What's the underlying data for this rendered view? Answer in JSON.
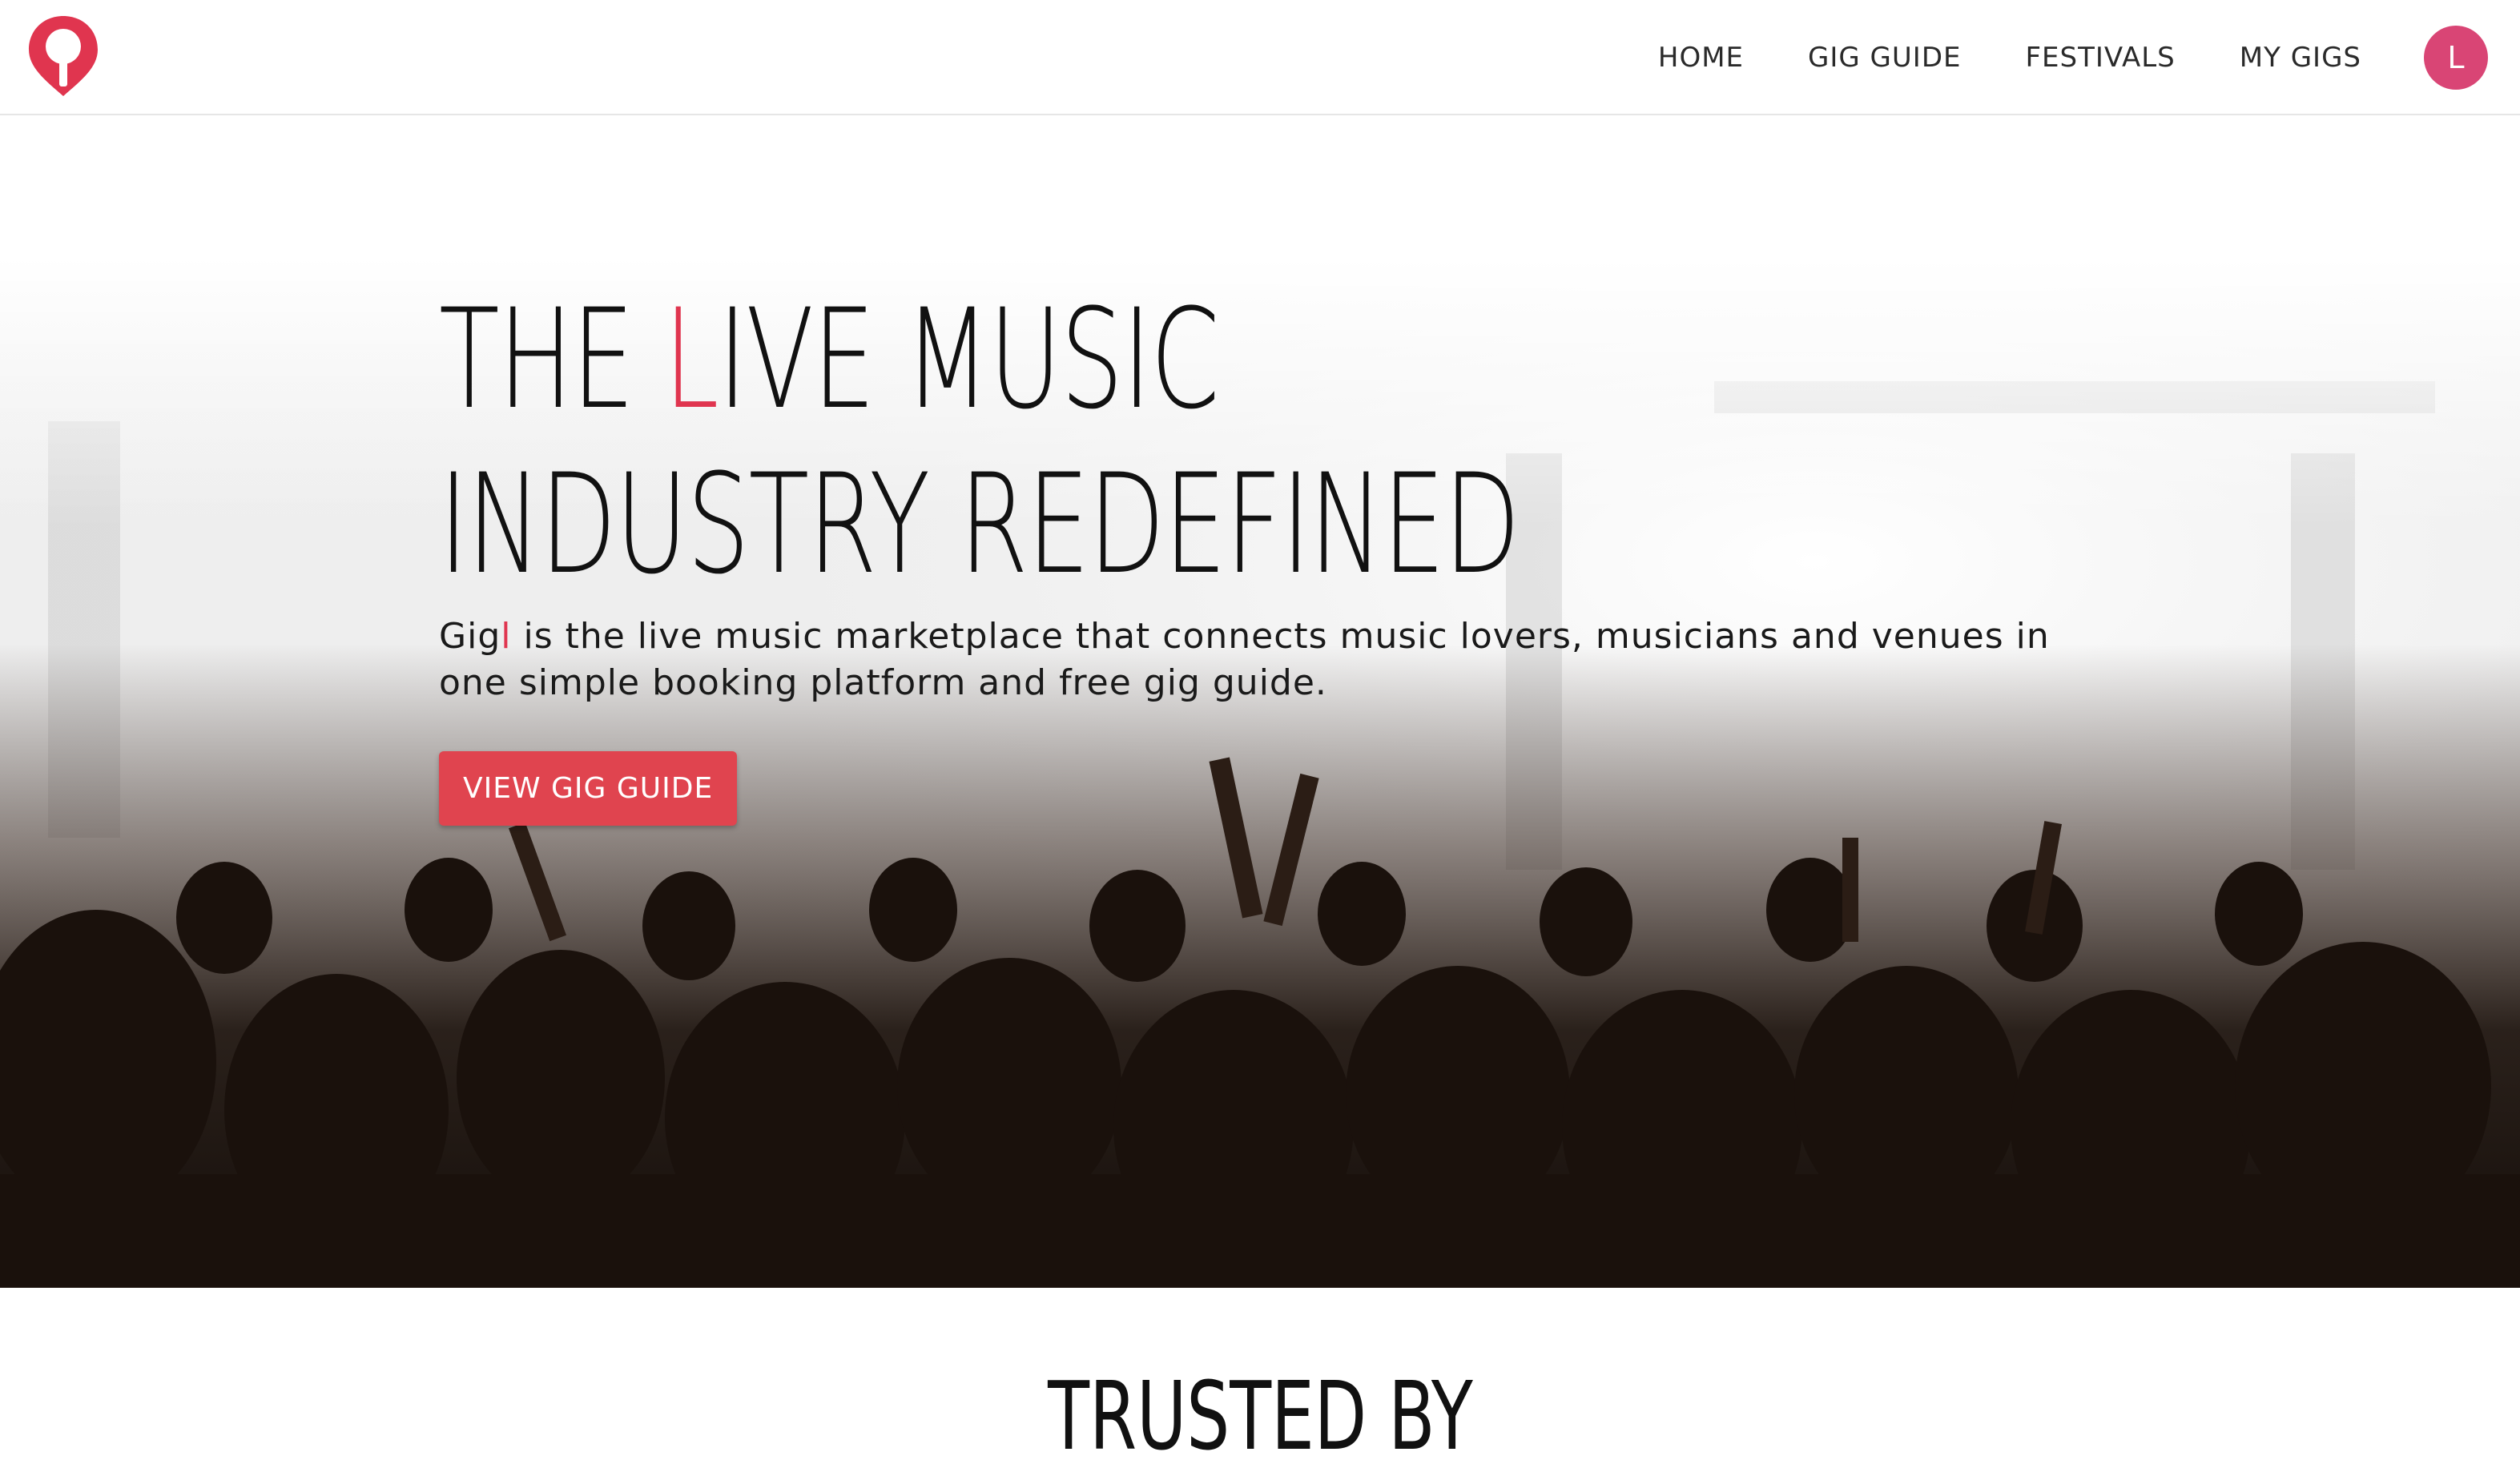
{
  "nav": {
    "logo_icon": "pin-guitar-logo",
    "items": [
      {
        "label": "HOME"
      },
      {
        "label": "GIG GUIDE"
      },
      {
        "label": "FESTIVALS"
      },
      {
        "label": "MY GIGS"
      }
    ],
    "avatar_initial": "L"
  },
  "hero": {
    "title_line1_part1": "THE ",
    "title_line1_accent": "L",
    "title_line1_part2": "IVE MUSIC",
    "title_line2": "INDUSTRY REDEFINED",
    "desc_brand": "Gig",
    "desc_brand_accent": "l",
    "desc_text": " is the live music marketplace that connects music lovers, musicians and venues in one simple booking platform and free gig guide.",
    "cta_label": "VIEW GIG GUIDE",
    "background": "concert-crowd-photo"
  },
  "trusted": {
    "title": "TRUSTED BY"
  },
  "colors": {
    "accent": "#e0354f",
    "button": "#e0444f",
    "avatar": "#d94575"
  }
}
